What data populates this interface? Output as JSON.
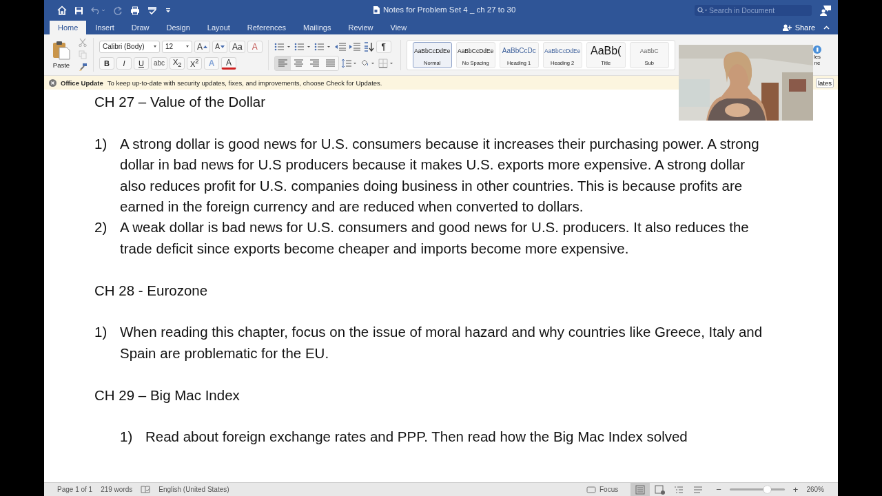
{
  "window": {
    "title": "Notes for Problem Set 4 _ ch 27 to 30",
    "search": {
      "placeholder": "Search in Document"
    }
  },
  "tabs": [
    {
      "label": "Home",
      "selected": true
    },
    {
      "label": "Insert",
      "selected": false
    },
    {
      "label": "Draw",
      "selected": false
    },
    {
      "label": "Design",
      "selected": false
    },
    {
      "label": "Layout",
      "selected": false
    },
    {
      "label": "References",
      "selected": false
    },
    {
      "label": "Mailings",
      "selected": false
    },
    {
      "label": "Review",
      "selected": false
    },
    {
      "label": "View",
      "selected": false
    }
  ],
  "share": "Share",
  "ribbon": {
    "paste": "Paste",
    "font_name": "Calibri (Body)",
    "font_size": "12",
    "font_tools": [
      "A",
      "A",
      "Aa",
      "A"
    ],
    "format_buttons": [
      {
        "label": "B",
        "kind": "bold"
      },
      {
        "label": "I",
        "kind": "italic"
      },
      {
        "label": "U",
        "kind": "underline"
      },
      {
        "label": "abc",
        "kind": "strike"
      },
      {
        "label": "X$_{2}$",
        "kind": "plain"
      },
      {
        "label": "X$^{2}$",
        "kind": "plain"
      }
    ],
    "effects": [
      {
        "label": "A",
        "kind": "outline"
      },
      {
        "label": "A",
        "kind": "font-color"
      }
    ],
    "pilcrow": "¶",
    "align": [
      {
        "selected": true
      },
      {
        "selected": false
      },
      {
        "selected": false
      },
      {
        "selected": false
      }
    ],
    "styles": [
      {
        "sample": "AaBbCcDdEe",
        "name": "Normal",
        "kind": "normal",
        "selected": true
      },
      {
        "sample": "AaBbCcDdEe",
        "name": "No Spacing",
        "kind": "normal",
        "selected": false
      },
      {
        "sample": "AaBbCcDc",
        "name": "Heading 1",
        "kind": "heading1",
        "selected": false
      },
      {
        "sample": "AaBbCcDdEe",
        "name": "Heading 2",
        "kind": "heading2",
        "selected": false
      },
      {
        "sample": "AaBb(",
        "name": "Title",
        "kind": "title",
        "selected": false
      },
      {
        "sample": "AaBbC",
        "name": "Sub",
        "kind": "subtle",
        "selected": false
      }
    ],
    "styles_pane": [
      "les",
      "ne"
    ]
  },
  "update_bar": {
    "title": "Office Update",
    "message": "To keep up-to-date with security updates, fixes, and improvements, choose Check for Updates.",
    "button": "lates"
  },
  "document": [
    {
      "heading": "CH 27 – Value of the Dollar",
      "items": [
        {
          "number": "1)",
          "text": "A strong dollar is good news for U.S. consumers because it increases their purchasing power.  A strong dollar in bad news for U.S producers because it makes U.S. exports more expensive.  A strong dollar also reduces profit for U.S. companies doing business in other countries.  This is because profits are earned in the foreign currency and are reduced when converted to dollars."
        },
        {
          "number": "2)",
          "text": "A weak dollar is bad news for U.S. consumers and good news for U.S. producers.  It also reduces the trade deficit since exports become cheaper and imports become more expensive."
        }
      ]
    },
    {
      "heading": "CH 28 - Eurozone",
      "items": [
        {
          "number": "1)",
          "text": "When reading this chapter, focus on the issue of moral hazard and why countries like Greece, Italy and Spain are problematic for the EU."
        }
      ]
    },
    {
      "heading": "CH 29 – Big Mac Index",
      "items": [
        {
          "number": "1)",
          "text": "Read about foreign exchange rates and PPP.  Then read how the Big Mac Index solved"
        }
      ]
    }
  ],
  "status_bar": {
    "page": "Page 1 of 1",
    "words": "219 words",
    "language": "English (United States)",
    "focus": "Focus",
    "views": [
      {
        "selected": true
      },
      {
        "selected": false
      },
      {
        "selected": false
      },
      {
        "selected": false
      }
    ],
    "zoom_out": "−",
    "zoom_in": "+",
    "zoom": {
      "level": 0.68
    },
    "zoom_text": "260%"
  }
}
